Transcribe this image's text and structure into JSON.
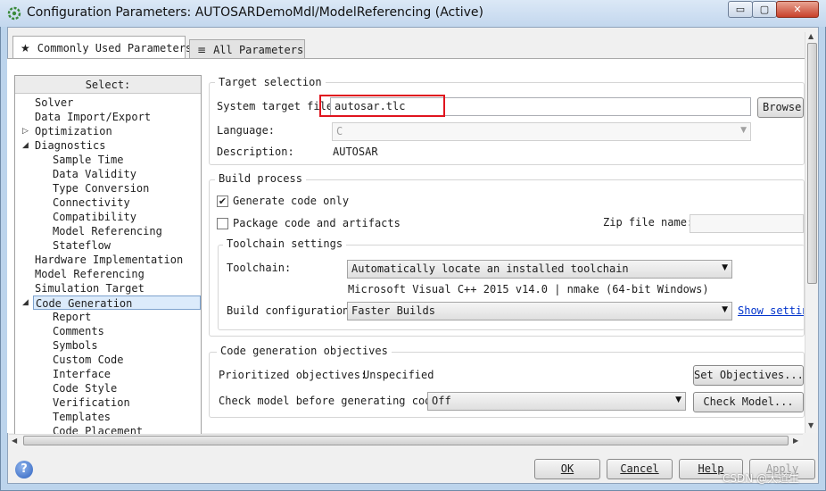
{
  "window": {
    "title": "Configuration Parameters: AUTOSARDemoMdl/ModelReferencing (Active)",
    "min": "▭",
    "max": "▢",
    "close": "✕"
  },
  "tabs": [
    {
      "icon": "★",
      "label": "Commonly Used Parameters"
    },
    {
      "icon": "≡",
      "label": "All Parameters"
    }
  ],
  "tree": {
    "header": "Select:",
    "items": [
      {
        "label": "Solver"
      },
      {
        "label": "Data Import/Export"
      },
      {
        "label": "Optimization",
        "arrow": "▷"
      },
      {
        "label": "Diagnostics",
        "arrow": "◢"
      },
      {
        "label": "Sample Time"
      },
      {
        "label": "Data Validity"
      },
      {
        "label": "Type Conversion"
      },
      {
        "label": "Connectivity"
      },
      {
        "label": "Compatibility"
      },
      {
        "label": "Model Referencing"
      },
      {
        "label": "Stateflow"
      },
      {
        "label": "Hardware Implementation"
      },
      {
        "label": "Model Referencing"
      },
      {
        "label": "Simulation Target"
      },
      {
        "label": "Code Generation",
        "arrow": "◢"
      },
      {
        "label": "Report"
      },
      {
        "label": "Comments"
      },
      {
        "label": "Symbols"
      },
      {
        "label": "Custom Code"
      },
      {
        "label": "Interface"
      },
      {
        "label": "Code Style"
      },
      {
        "label": "Verification"
      },
      {
        "label": "Templates"
      },
      {
        "label": "Code Placement"
      }
    ]
  },
  "target_selection": {
    "title": "Target selection",
    "system_target_label": "System target file:",
    "system_target_value": "autosar.tlc",
    "browse_label": "Browse...",
    "language_label": "Language:",
    "language_value": "C",
    "description_label": "Description:",
    "description_value": "AUTOSAR"
  },
  "build_process": {
    "title": "Build process",
    "generate_code_only_label": "Generate code only",
    "generate_code_only_checked": true,
    "package_label": "Package code and artifacts",
    "package_checked": false,
    "zip_label": "Zip file name:",
    "zip_value": "",
    "toolchain_settings_title": "Toolchain settings",
    "toolchain_label": "Toolchain:",
    "toolchain_value": "Automatically locate an installed toolchain",
    "toolchain_info": "Microsoft Visual C++ 2015 v14.0 | nmake (64-bit Windows)",
    "build_config_label": "Build configuration:",
    "build_config_value": "Faster Builds",
    "show_settings_link": "Show settings"
  },
  "objectives": {
    "title": "Code generation objectives",
    "prioritized_label": "Prioritized objectives:",
    "prioritized_value": "Unspecified",
    "set_objectives_label": "Set Objectives...",
    "check_model_label": "Check model before generating code:",
    "check_model_value": "Off",
    "check_model_button": "Check Model..."
  },
  "footer": {
    "ok": "OK",
    "cancel": "Cancel",
    "help": "Help",
    "apply": "Apply",
    "help_icon": "?"
  },
  "watermark": "CSDN @大道生"
}
